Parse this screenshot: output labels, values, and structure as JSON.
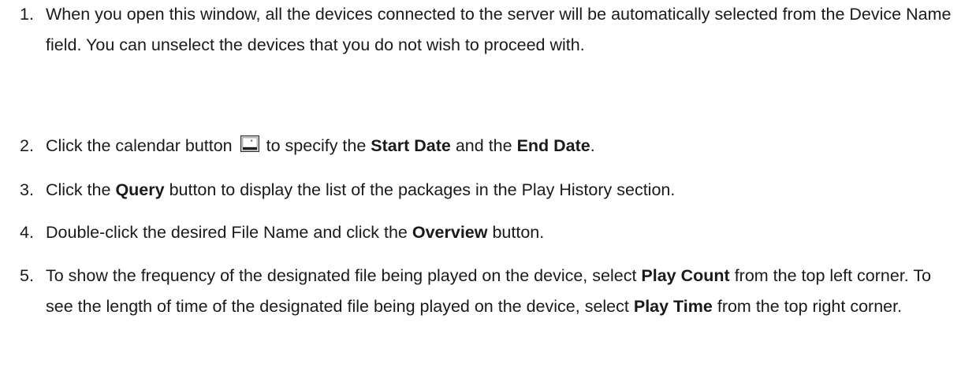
{
  "steps": [
    {
      "number": "1.",
      "text": "When you open this window, all the devices connected to the server will be automatically selected from the Device Name field. You can unselect the devices that you do not wish to proceed with."
    },
    {
      "number": "2.",
      "text_before_icon": "Click the calendar button",
      "icon": "calendar-button-icon",
      "text_after_icon": "to specify the",
      "bold_1": "Start Date",
      "text_mid": "and the",
      "bold_2": "End Date",
      "text_end": "."
    },
    {
      "number": "3.",
      "text_before": "Click the",
      "bold": "Query",
      "text_after": "button to display the list of the packages in the Play History section."
    },
    {
      "number": "4.",
      "text_before": "Double-click the desired File Name and click the",
      "bold": "Overview",
      "text_after": "button."
    },
    {
      "number": "5.",
      "text_1": "To show the frequency of the designated file being played on the device, select",
      "bold_1": "Play Count",
      "text_2": "from the top left corner. To see the length of time of the designated file being played on the device, select",
      "bold_2": "Play Time",
      "text_3": "from the top right corner."
    }
  ]
}
